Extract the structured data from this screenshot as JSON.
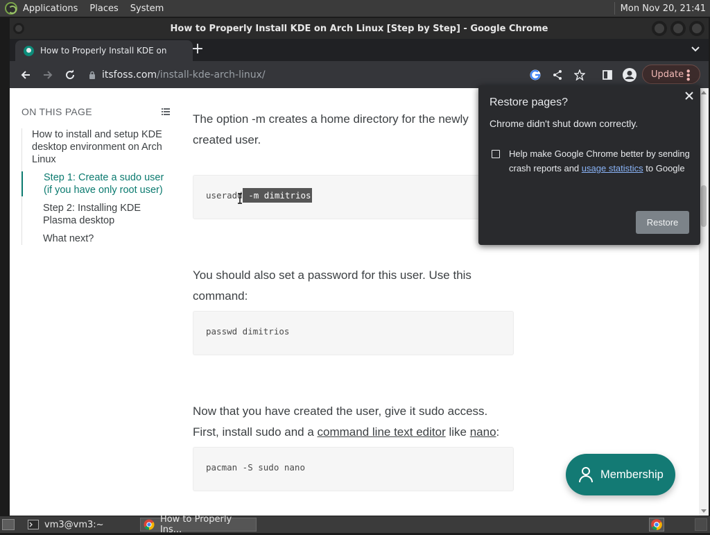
{
  "top_panel": {
    "menus": [
      "Applications",
      "Places",
      "System"
    ],
    "clock": "Mon Nov 20, 21:41"
  },
  "window": {
    "title": "How to Properly Install KDE on Arch Linux [Step by Step] - Google Chrome"
  },
  "tab": {
    "title": "How to Properly Install KDE on Arch Linux [Step by Step]"
  },
  "address": {
    "host": "itsfoss.com",
    "path": "/install-kde-arch-linux/"
  },
  "toolbar": {
    "update_label": "Update"
  },
  "toc": {
    "heading": "ON THIS PAGE",
    "items": [
      "How to install and setup KDE desktop environment on Arch Linux",
      "Step 1: Create a sudo user (if you have only root user)",
      "Step 2: Installing KDE Plasma desktop",
      "What next?"
    ]
  },
  "article": {
    "p1": "The option -m creates a home directory for the newly created user.",
    "code1_pre": "useradd",
    "code1_sel": " -m dimitrios",
    "p2": "You should also set a password for this user. Use this command:",
    "code2": "passwd dimitrios",
    "p3_a": "Now that you have created the user, give it sudo access. First, install sudo and a ",
    "p3_link1": "command line text editor",
    "p3_b": " like ",
    "p3_link2": "nano",
    "p3_c": ":",
    "code3": "pacman -S sudo nano"
  },
  "membership_label": "Membership",
  "restore": {
    "title": "Restore pages?",
    "description": "Chrome didn't shut down correctly.",
    "checkbox_text": "Help make Google Chrome better by sending crash reports and ",
    "checkbox_link": "usage statistics",
    "checkbox_tail": " to Google",
    "button": "Restore"
  },
  "bottom_panel": {
    "tasks": [
      "vm3@vm3:~",
      "How to Properly Ins..."
    ]
  },
  "colors": {
    "accent": "#0b7a6f",
    "membership": "#137a74",
    "link_dark": "#8ab4f8"
  }
}
